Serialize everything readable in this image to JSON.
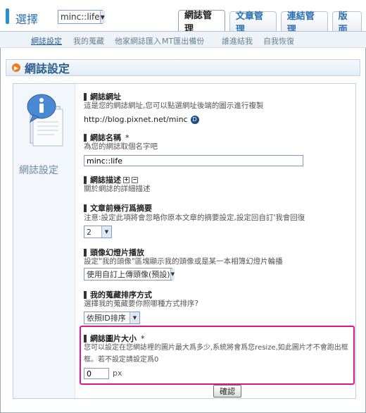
{
  "header": {
    "select_label": "選擇",
    "blog_select_value": "minc::life",
    "tabs": [
      {
        "label": "網誌管理",
        "active": true
      },
      {
        "label": "文章管理",
        "active": false
      },
      {
        "label": "連結管理",
        "active": false
      },
      {
        "label": "版面",
        "active": false
      }
    ]
  },
  "subnav": {
    "items": [
      "網誌設定",
      "我的蒐藏",
      "他家網誌匯入",
      "MT匯出備份",
      "誰進結我",
      "自我恢復"
    ]
  },
  "page": {
    "title": "網誌設定",
    "left_caption": "網誌設定"
  },
  "sections": {
    "url": {
      "title": "網誌網址",
      "desc": "這是您的網誌網址,您可以點選網址後端的圖示進行複製",
      "value": "http://blog.pixnet.net/minc"
    },
    "name": {
      "title": "網誌名稱",
      "required_mark": "*",
      "desc": "為您的網誌取個名字吧",
      "value": "minc::life"
    },
    "description": {
      "title": "網誌描述",
      "plus": "+",
      "minus": "−",
      "desc": "關於網誌的詳細描述"
    },
    "summary_lines": {
      "title": "文章前幾行爲摘要",
      "desc": "注意:設定此項將會忽略你原本文章的摘要設定,設定回自訂'我會回復",
      "value": "2"
    },
    "avatar_slideshow": {
      "title": "頭像幻燈片播放",
      "desc": "設定\"我的頭像\"區塊顯示我的頭像或是某一本相簿幻燈片輪播",
      "value": "使用自訂上傳頭像(預設)"
    },
    "favorites_sort": {
      "title": "我的蒐藏排序方式",
      "desc": "選擇我的蒐藏要你照哪種方式排序?",
      "value": "依照ID排序"
    },
    "image_size": {
      "title": "網誌圖片大小",
      "required_mark": "*",
      "desc_line1": "您可以設定在您網誌裡的圖片最大爲多少,系統將會爲您resize,如此圖片才不會跑出框",
      "desc_line2": "框。若不設定請設定爲0",
      "value": "0",
      "unit": "px"
    }
  },
  "confirm_label": "確認",
  "colors": {
    "accent_blue": "#2a6fb0",
    "highlight_pink": "#e0168b",
    "orange": "#ef7a1a"
  }
}
